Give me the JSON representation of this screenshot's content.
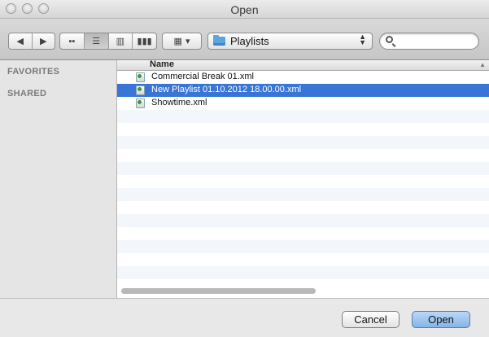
{
  "window": {
    "title": "Open"
  },
  "toolbar": {
    "back_glyph": "◀",
    "forward_glyph": "▶",
    "view_modes": [
      {
        "glyph": "▪▪",
        "active": false
      },
      {
        "glyph": "☰",
        "active": true
      },
      {
        "glyph": "▥",
        "active": false
      },
      {
        "glyph": "▮▮▮",
        "active": false
      }
    ],
    "arrange_glyph": "▦",
    "arrange_caret": "▾",
    "path_label": "Playlists",
    "search_placeholder": ""
  },
  "sidebar": {
    "sections": [
      "FAVORITES",
      "SHARED"
    ]
  },
  "filelist": {
    "column_name": "Name",
    "sort_indicator": "▲",
    "files": [
      {
        "name": "Commercial Break 01.xml",
        "selected": false
      },
      {
        "name": "New Playlist 01.10.2012 18.00.00.xml",
        "selected": true
      },
      {
        "name": "Showtime.xml",
        "selected": false
      }
    ]
  },
  "buttons": {
    "cancel": "Cancel",
    "open": "Open"
  },
  "colors": {
    "selection": "#3875d7",
    "default_button": "#86b4e7"
  }
}
